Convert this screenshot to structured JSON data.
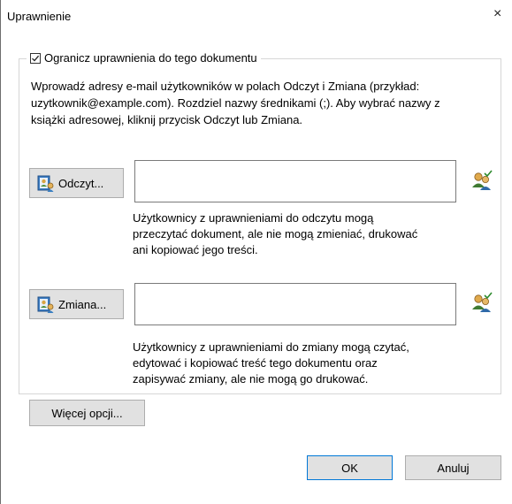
{
  "dialog": {
    "title": "Uprawnienie",
    "close_glyph": "×"
  },
  "restrict": {
    "checked": true,
    "label": "Ogranicz uprawnienia do tego dokumentu"
  },
  "description": {
    "line1": "Wprowadź adresy e-mail użytkowników w polach Odczyt i Zmiana (przykład:",
    "line2": "uzytkownik@example.com). Rozdziel nazwy średnikami (;). Aby wybrać nazwy z",
    "line3": "książki adresowej, kliknij przycisk Odczyt lub Zmiana."
  },
  "read": {
    "button_label": "Odczyt...",
    "value": "",
    "help_line1": "Użytkownicy z uprawnieniami do odczytu mogą",
    "help_line2": "przeczytać dokument, ale nie mogą zmieniać, drukować",
    "help_line3": "ani kopiować jego treści."
  },
  "change": {
    "button_label": "Zmiana...",
    "value": "",
    "help_line1": "Użytkownicy z uprawnieniami do zmiany mogą czytać,",
    "help_line2": "edytować i kopiować treść tego dokumentu oraz",
    "help_line3": "zapisywać zmiany, ale nie mogą go drukować."
  },
  "more_options_label": "Więcej opcji...",
  "footer": {
    "ok_label": "OK",
    "cancel_label": "Anuluj"
  },
  "icons": {
    "read_button": "address-book-icon",
    "change_button": "address-book-icon",
    "read_check_names": "check-names-icon",
    "change_check_names": "check-names-icon",
    "close": "close-icon",
    "checkbox": "checkmark-icon"
  }
}
